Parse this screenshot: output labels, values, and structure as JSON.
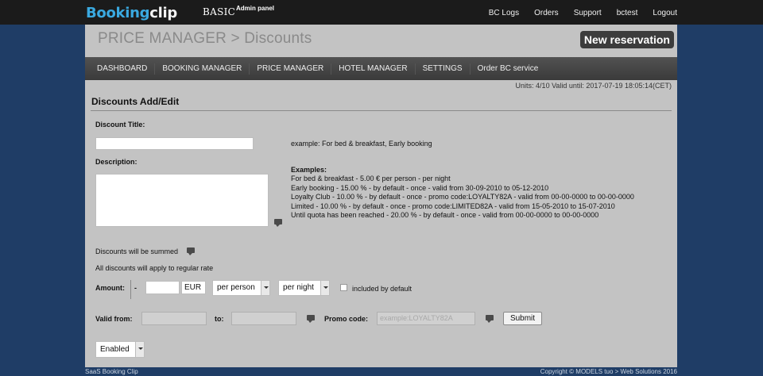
{
  "brand": {
    "part1": "Booking",
    "part2": "clip",
    "edition": "BASIC",
    "subtitle": "Admin panel"
  },
  "topnav": [
    "BC Logs",
    "Orders",
    "Support",
    "bctest",
    "Logout"
  ],
  "header": {
    "title": "PRICE MANAGER > Discounts",
    "new_reservation": "New reservation"
  },
  "menu": [
    "DASHBOARD",
    "BOOKING MANAGER",
    "PRICE MANAGER",
    "HOTEL MANAGER",
    "SETTINGS",
    "Order BC service"
  ],
  "units": "Units: 4/10 Valid until: 2017-07-19 18:05:14(CET)",
  "form": {
    "section_title": "Discounts Add/Edit",
    "title_label": "Discount Title:",
    "title_value": "",
    "title_example": "example: For bed & breakfast, Early booking",
    "description_label": "Description:",
    "description_value": "",
    "examples_heading": "Examples:",
    "examples": [
      "For bed & breakfast - 5.00 € per person - per night",
      "Early booking - 15.00 % - by default - once - valid from 30-09-2010 to 05-12-2010",
      "Loyalty Club - 10.00 % - by default - once - promo code:LOYALTY82A - valid from 00-00-0000 to 00-00-0000",
      "Limited - 10.00 % - by default - once - promo code:LIMITED82A - valid from 15-05-2010 to 15-07-2010",
      "Until quota has been reached - 20.00 % - by default - once - valid from 00-00-0000 to 00-00-0000"
    ],
    "summed_text": "Discounts will be summed",
    "regular_rate_text": "All discounts will apply to regular rate",
    "amount_label": "Amount:",
    "amount_sign": "-",
    "amount_value": "",
    "currency": "EUR",
    "per_person": "per person",
    "per_night": "per night",
    "included_label": "included by default",
    "valid_from_label": "Valid from:",
    "valid_from_value": "",
    "to_label": "to:",
    "to_value": "",
    "promo_label": "Promo code:",
    "promo_placeholder": "example:LOYALTY82A",
    "submit": "Submit",
    "status": "Enabled"
  },
  "footer": {
    "left": "SaaS Booking Clip",
    "right": "Copyright © MODELS tuo > Web Solutions 2016"
  }
}
